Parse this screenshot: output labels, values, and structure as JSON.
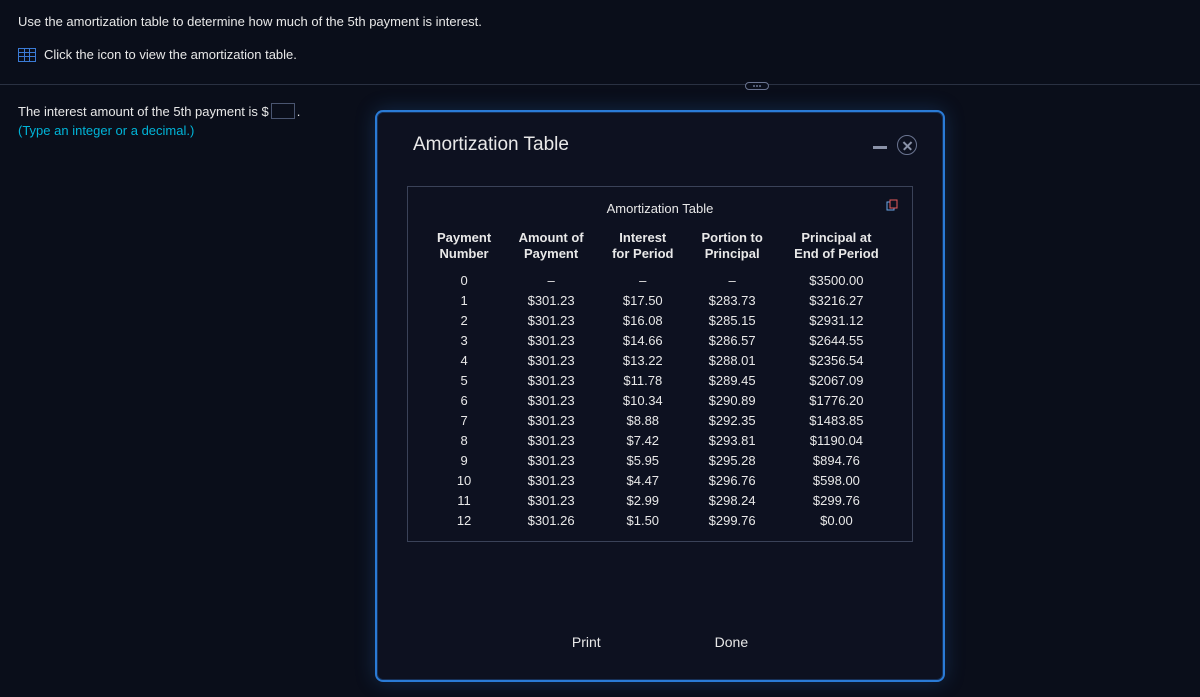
{
  "question": {
    "prompt": "Use the amortization table to determine how much of the 5th payment is interest.",
    "icon_instruction": "Click the icon to view the amortization table."
  },
  "answer": {
    "prefix": "The interest amount of the 5th payment is $",
    "value": "",
    "suffix": ".",
    "hint": "(Type an integer or a decimal.)"
  },
  "popup": {
    "title": "Amortization Table",
    "inner_title": "Amortization Table",
    "headers": {
      "c0": "Payment\nNumber",
      "c1": "Amount of\nPayment",
      "c2": "Interest\nfor Period",
      "c3": "Portion to\nPrincipal",
      "c4": "Principal at\nEnd of Period"
    },
    "rows": [
      {
        "n": "0",
        "amt": "–",
        "int": "–",
        "pr": "–",
        "bal": "$3500.00"
      },
      {
        "n": "1",
        "amt": "$301.23",
        "int": "$17.50",
        "pr": "$283.73",
        "bal": "$3216.27"
      },
      {
        "n": "2",
        "amt": "$301.23",
        "int": "$16.08",
        "pr": "$285.15",
        "bal": "$2931.12"
      },
      {
        "n": "3",
        "amt": "$301.23",
        "int": "$14.66",
        "pr": "$286.57",
        "bal": "$2644.55"
      },
      {
        "n": "4",
        "amt": "$301.23",
        "int": "$13.22",
        "pr": "$288.01",
        "bal": "$2356.54"
      },
      {
        "n": "5",
        "amt": "$301.23",
        "int": "$11.78",
        "pr": "$289.45",
        "bal": "$2067.09"
      },
      {
        "n": "6",
        "amt": "$301.23",
        "int": "$10.34",
        "pr": "$290.89",
        "bal": "$1776.20"
      },
      {
        "n": "7",
        "amt": "$301.23",
        "int": "$8.88",
        "pr": "$292.35",
        "bal": "$1483.85"
      },
      {
        "n": "8",
        "amt": "$301.23",
        "int": "$7.42",
        "pr": "$293.81",
        "bal": "$1190.04"
      },
      {
        "n": "9",
        "amt": "$301.23",
        "int": "$5.95",
        "pr": "$295.28",
        "bal": "$894.76"
      },
      {
        "n": "10",
        "amt": "$301.23",
        "int": "$4.47",
        "pr": "$296.76",
        "bal": "$598.00"
      },
      {
        "n": "11",
        "amt": "$301.23",
        "int": "$2.99",
        "pr": "$298.24",
        "bal": "$299.76"
      },
      {
        "n": "12",
        "amt": "$301.26",
        "int": "$1.50",
        "pr": "$299.76",
        "bal": "$0.00"
      }
    ],
    "buttons": {
      "print": "Print",
      "done": "Done"
    }
  }
}
